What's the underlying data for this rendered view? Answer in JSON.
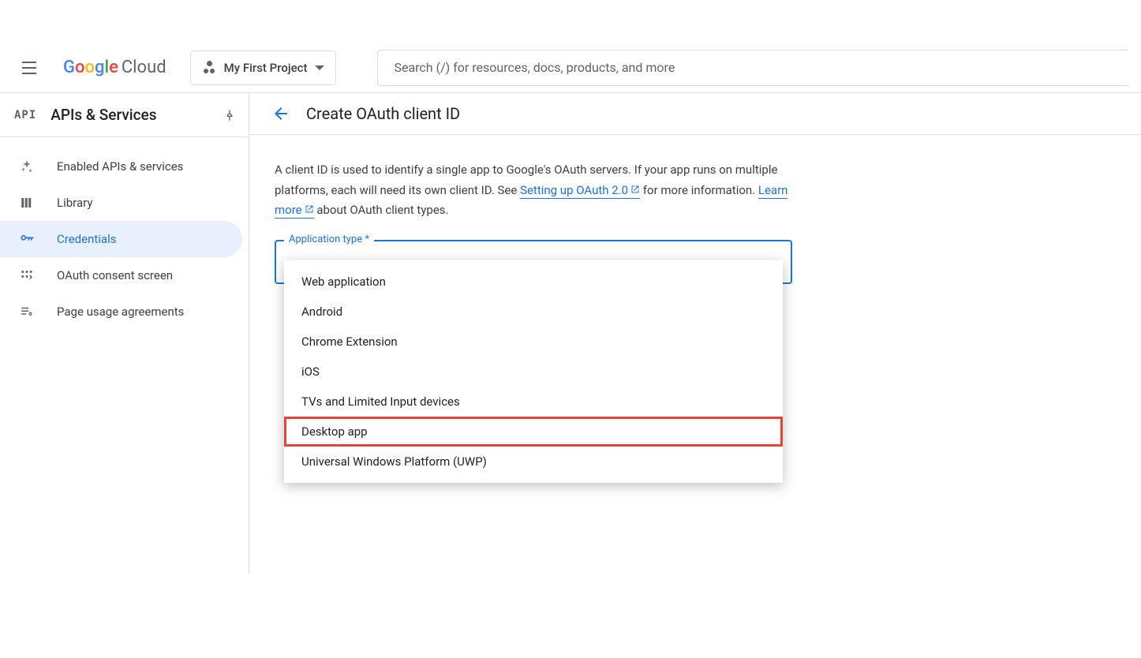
{
  "header": {
    "logo_cloud": "Cloud",
    "project_name": "My First Project",
    "search_placeholder": "Search (/) for resources, docs, products, and more"
  },
  "sidebar": {
    "api_label": "API",
    "title": "APIs & Services",
    "items": [
      {
        "label": "Enabled APIs & services"
      },
      {
        "label": "Library"
      },
      {
        "label": "Credentials"
      },
      {
        "label": "OAuth consent screen"
      },
      {
        "label": "Page usage agreements"
      }
    ]
  },
  "content": {
    "page_title": "Create OAuth client ID",
    "description_part1": "A client ID is used to identify a single app to Google's OAuth servers. If your app runs on multiple platforms, each will need its own client ID. See ",
    "link1": "Setting up OAuth 2.0",
    "description_part2": " for more information. ",
    "link2": "Learn more",
    "description_part3": " about OAuth client types.",
    "select_label": "Application type *",
    "options": [
      "Web application",
      "Android",
      "Chrome Extension",
      "iOS",
      "TVs and Limited Input devices",
      "Desktop app",
      "Universal Windows Platform (UWP)"
    ],
    "highlighted_option_index": 5
  }
}
